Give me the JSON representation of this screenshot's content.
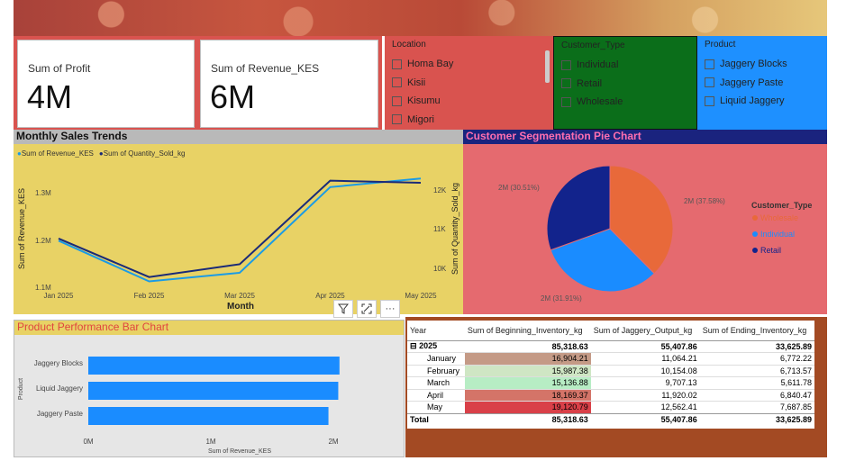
{
  "kpis": [
    {
      "label": "Sum of Profit",
      "value": "4M"
    },
    {
      "label": "Sum of Revenue_KES",
      "value": "6M"
    }
  ],
  "slicers": {
    "location": {
      "title": "Location",
      "items": [
        "Homa Bay",
        "Kisii",
        "Kisumu",
        "Migori"
      ],
      "bg": "#d9534f"
    },
    "customer_type": {
      "title": "Customer_Type",
      "items": [
        "Individual",
        "Retail",
        "Wholesale"
      ],
      "bg": "#0b6e1a"
    },
    "product": {
      "title": "Product",
      "items": [
        "Jaggery Blocks",
        "Jaggery Paste",
        "Liquid Jaggery"
      ],
      "bg": "#1e90ff"
    }
  },
  "monthly": {
    "title": "Monthly Sales Trends",
    "legend": [
      "Sum of Revenue_KES",
      "Sum of Quantity_Sold_kg"
    ],
    "y_left_title": "Sum of Revenue_KES",
    "y_right_title": "Sum of Quantity_Sold_kg",
    "x_title": "Month",
    "y_left_ticks": [
      "1.3M",
      "1.2M",
      "1.1M"
    ],
    "y_right_ticks": [
      "12K",
      "11K",
      "10K"
    ],
    "colors": {
      "revenue": "#1a9be6",
      "quantity": "#1a2a78"
    }
  },
  "pie": {
    "title": "Customer Segmentation Pie Chart",
    "legend_title": "Customer_Type",
    "labels": [
      "2M (37.58%)",
      "2M (31.91%)",
      "2M (30.51%)"
    ]
  },
  "bar": {
    "title": "Product Performance Bar Chart",
    "y_title": "Product",
    "x_title": "Sum of Revenue_KES",
    "x_ticks": [
      "0M",
      "1M",
      "2M"
    ]
  },
  "toolbar": {
    "filter_icon": "filter-icon",
    "focus_icon": "focus-mode-icon",
    "more_label": "···"
  },
  "matrix": {
    "headers": [
      "Year",
      "Sum of Beginning_Inventory_kg",
      "Sum of Jaggery_Output_kg",
      "Sum of Ending_Inventory_kg"
    ],
    "year_row": {
      "label": "2025",
      "toggle": "⊟",
      "values": [
        "85,318.63",
        "55,407.86",
        "33,625.89"
      ]
    },
    "rows": [
      {
        "label": "January",
        "values": [
          "16,904.21",
          "11,064.21",
          "6,772.22"
        ],
        "color": "#c49a86"
      },
      {
        "label": "February",
        "values": [
          "15,987.38",
          "10,154.08",
          "6,713.57"
        ],
        "color": "#cfe6c4"
      },
      {
        "label": "March",
        "values": [
          "15,136.88",
          "9,707.13",
          "5,611.78"
        ],
        "color": "#b7edc4"
      },
      {
        "label": "April",
        "values": [
          "18,169.37",
          "11,920.02",
          "6,840.47"
        ],
        "color": "#d47468"
      },
      {
        "label": "May",
        "values": [
          "19,120.79",
          "12,562.41",
          "7,687.85"
        ],
        "color": "#d94048"
      }
    ],
    "total_row": {
      "label": "Total",
      "values": [
        "85,318.63",
        "55,407.86",
        "33,625.89"
      ]
    }
  },
  "chart_data": [
    {
      "type": "line",
      "title": "Monthly Sales Trends",
      "xlabel": "Month",
      "ylabel": "Sum of Revenue_KES",
      "x": [
        "Jan 2025",
        "Feb 2025",
        "Mar 2025",
        "Apr 2025",
        "May 2025"
      ],
      "series": [
        {
          "name": "Sum of Revenue_KES",
          "axis": "left",
          "values": [
            1195000,
            1100000,
            1120000,
            1320000,
            1340000
          ]
        },
        {
          "name": "Sum of Quantity_Sold_kg",
          "axis": "right",
          "values": [
            10900,
            10000,
            10300,
            12250,
            12200
          ]
        }
      ],
      "ylim_left": [
        1080000,
        1370000
      ],
      "ylim_right": [
        9700,
        12600
      ],
      "legend": "top-left"
    },
    {
      "type": "pie",
      "title": "Customer Segmentation Pie Chart",
      "categories": [
        "Wholesale",
        "Individual",
        "Retail"
      ],
      "values": [
        37.58,
        31.91,
        30.51
      ],
      "colors": [
        "#e8693a",
        "#1a8cff",
        "#12238c"
      ],
      "legend": "right"
    },
    {
      "type": "bar",
      "title": "Product Performance Bar Chart",
      "xlabel": "Sum of Revenue_KES",
      "ylabel": "Product",
      "categories": [
        "Jaggery Blocks",
        "Liquid Jaggery",
        "Jaggery Paste"
      ],
      "values": [
        2050000,
        2040000,
        1960000
      ],
      "xlim": [
        0,
        2200000
      ],
      "color": "#1a8cff"
    }
  ]
}
